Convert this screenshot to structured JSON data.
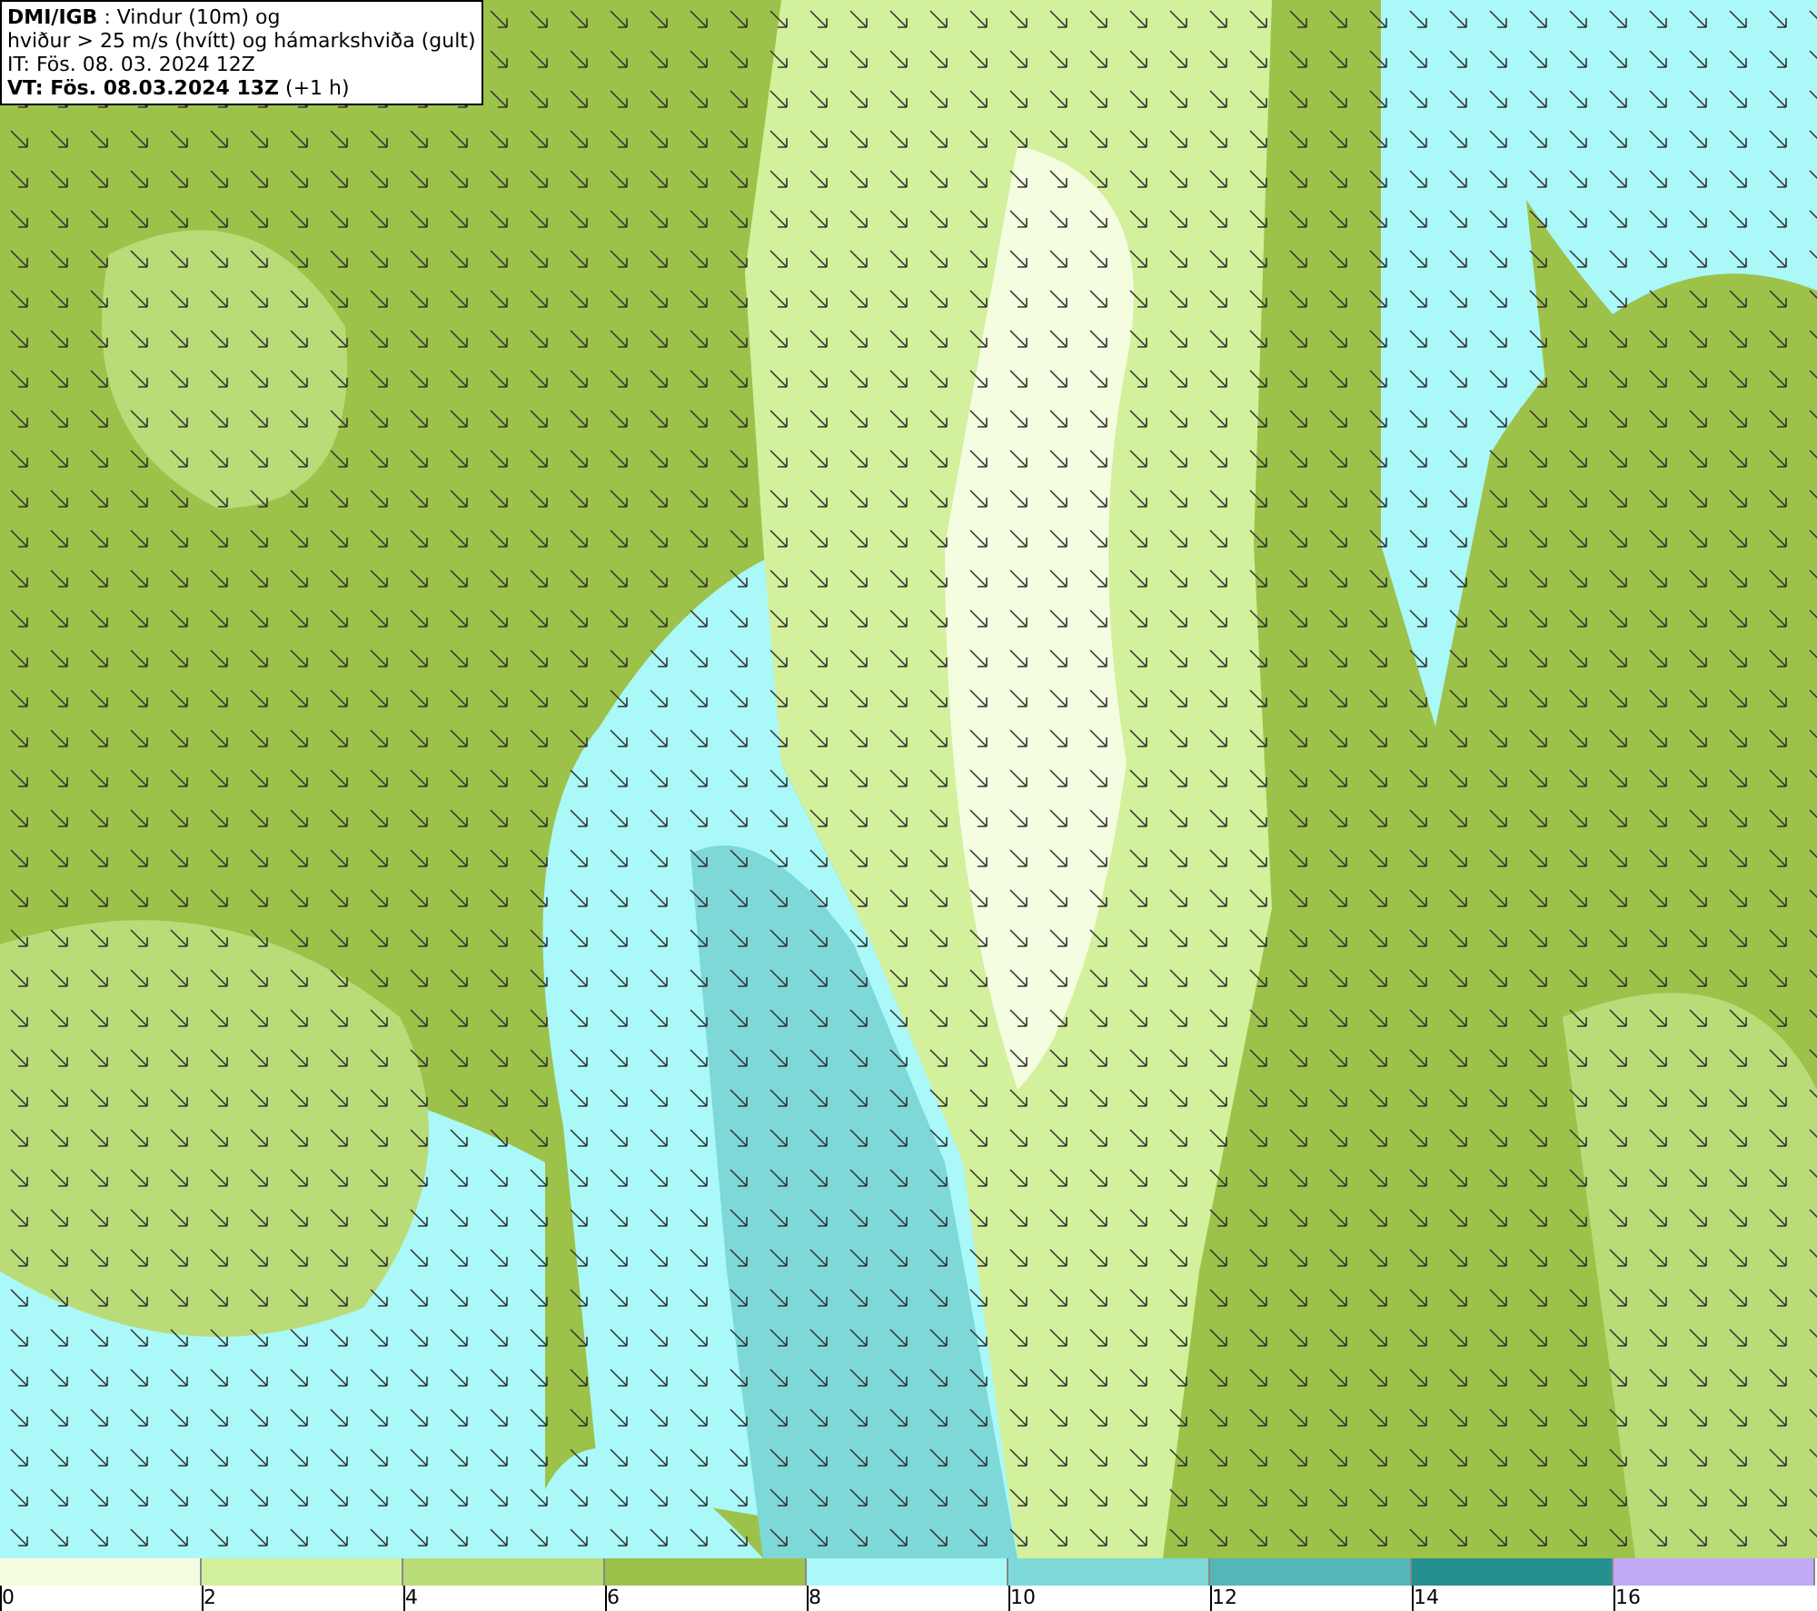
{
  "header": {
    "lines": [
      "**DMI/IGB** : Vindur (10m) og",
      "hviður > 25 m/s (hvítt) og hámarkshviða (gult)",
      "IT: Fös. 08. 03. 2024 12Z",
      "**VT: Fös. 08.03.2024 13Z** (+1 h)"
    ]
  },
  "legend": {
    "bins": [
      {
        "color": "#f4fde0",
        "label": "0"
      },
      {
        "color": "#d3f09c",
        "label": "2"
      },
      {
        "color": "#b9dc78",
        "label": "4"
      },
      {
        "color": "#9dc24a",
        "label": "6"
      },
      {
        "color": "#aaf8f8",
        "label": "8"
      },
      {
        "color": "#7ed8d8",
        "label": "10"
      },
      {
        "color": "#54b6b6",
        "label": "12"
      },
      {
        "color": "#249090",
        "label": "14"
      },
      {
        "color": "#c0aaf6",
        "label": "16"
      }
    ]
  }
}
